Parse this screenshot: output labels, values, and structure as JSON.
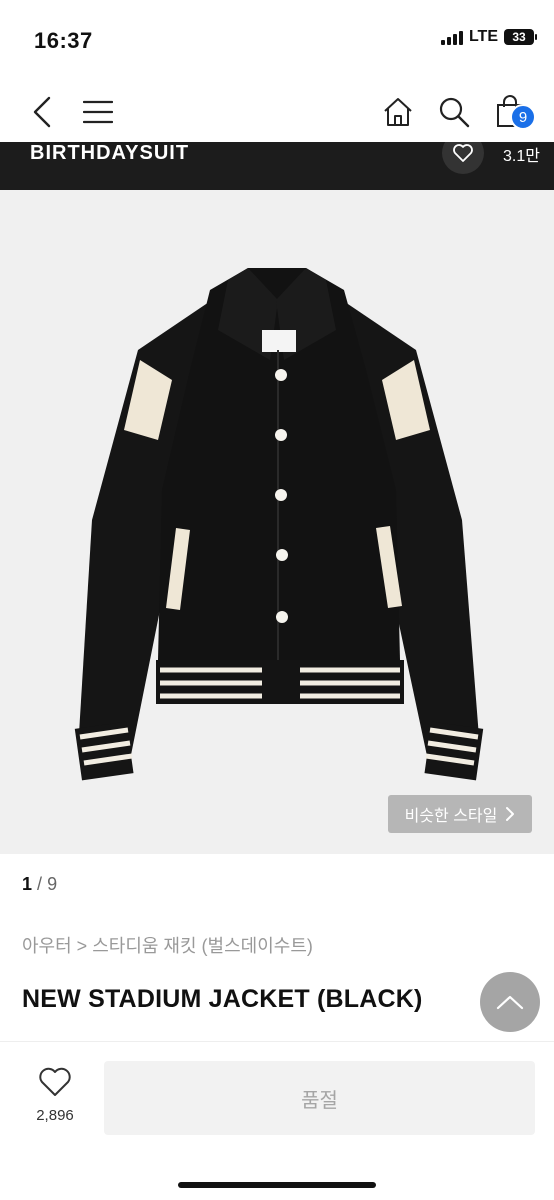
{
  "status": {
    "time": "16:37",
    "network": "LTE",
    "battery": "33"
  },
  "nav": {
    "cart_count": "9"
  },
  "brand": {
    "name": "BIRTHDAYSUIT",
    "likes": "3.1만"
  },
  "gallery": {
    "similar_label": "비슷한 스타일",
    "current": "1",
    "separator": "/",
    "total": "9"
  },
  "product": {
    "breadcrumb": "아우터 > 스타디움 재킷 (벌스데이수트)",
    "title": "NEW STADIUM JACKET (BLACK)"
  },
  "actions": {
    "like_count": "2,896",
    "buy_label": "품절"
  },
  "colors": {
    "accent": "#1a6fe8",
    "brandbar": "#1c1c1c",
    "soldout_bg": "#f2f2f2"
  }
}
